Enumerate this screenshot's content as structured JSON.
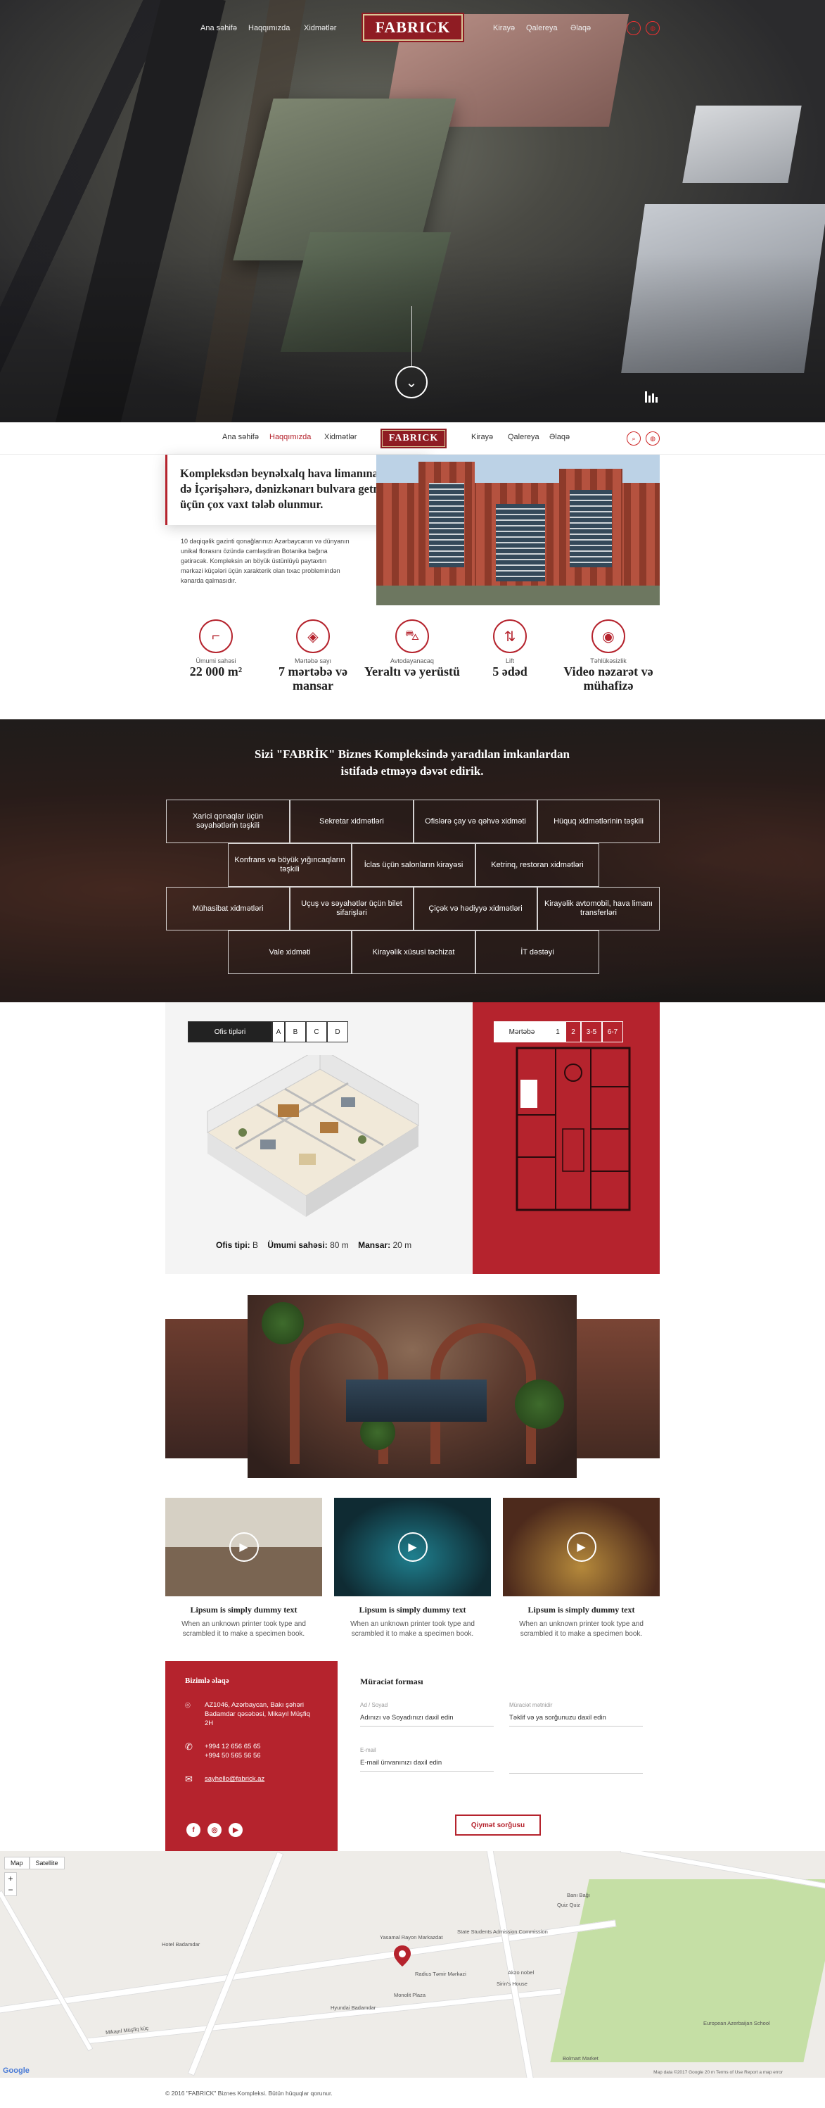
{
  "nav": {
    "items_left": [
      "Ana səhifə",
      "Haqqımızda",
      "Xidmətlər"
    ],
    "items_right": [
      "Kirayə",
      "Qalereya",
      "Əlaqə"
    ],
    "logo": "FABRICK",
    "active": "Haqqımızda"
  },
  "about": {
    "headline": "Kompleksdən beynəlxalq hava limanına, eləcə də İçərişəhərə, dənizkənarı bulvara getmək üçün çox vaxt tələb olunmur.",
    "text": "10 dəqiqəlik gəzinti qonağlarınızı Azərbaycanın və dünyanın unikal florasını özündə cəmləşdirən Botanika bağına gətirəcək. Kompleksin ən böyük üstünlüyü paytaxtın mərkəzi küçələri üçün xarakterik olan tıxac problemindən kənarda qalmasıdır."
  },
  "features": [
    {
      "label": "Ümumi sahəsi",
      "value": "22 000 m²",
      "icon": "area-icon"
    },
    {
      "label": "Mərtəbə sayı",
      "value": "7 mərtəbə və mansar",
      "icon": "layers-icon"
    },
    {
      "label": "Avtodayanacaq",
      "value": "Yeraltı və yerüstü",
      "icon": "car-icon"
    },
    {
      "label": "Lift",
      "value": "5 ədəd",
      "icon": "lift-icon"
    },
    {
      "label": "Təhlükəsizlik",
      "value": "Video nəzarət və mühafizə",
      "icon": "camera-icon"
    }
  ],
  "services": {
    "title": "Sizi \"FABRİK\" Biznes Kompleksində yaradılan imkanlardan istifadə etməyə dəvət edirik.",
    "items": [
      "Xarici qonaqlar üçün səyahətlərin təşkili",
      "Sekretar xidmətləri",
      "Ofislərə çay və qəhvə xidməti",
      "Hüquq xidmətlərinin təşkili",
      "Konfrans və böyük yığıncaqların təşkili",
      "İclas üçün salonların kirayəsi",
      "Ketrinq, restoran xidmətləri",
      "Mühasibat xidmətləri",
      "Uçuş və səyahətlər üçün bilet sifarişləri",
      "Çiçək və hədiyyə xidmətləri",
      "Kirayəlik avtomobil, hava limanı transferləri",
      "Vale xidməti",
      "Kirayəlik xüsusi təchizat",
      "İT dəstəyi"
    ]
  },
  "plans": {
    "office_tab_label": "Ofis tipləri",
    "office_tabs": [
      "A",
      "B",
      "C",
      "D"
    ],
    "floor_tab_label": "Mərtəbə",
    "floor_tabs": [
      "1",
      "2",
      "3-5",
      "6-7"
    ],
    "caption": {
      "type_label": "Ofis tipi:",
      "type_value": "B",
      "area_label": "Ümumi sahəsi:",
      "area_value": "80 m",
      "attic_label": "Mansar:",
      "attic_value": "20 m"
    }
  },
  "videos": [
    {
      "title": "Lipsum is simply dummy text",
      "desc": "When an unknown printer took type and scrambled it to make a specimen book."
    },
    {
      "title": "Lipsum is simply dummy text",
      "desc": "When an unknown printer took type and scrambled it to make a specimen book."
    },
    {
      "title": "Lipsum is simply dummy text",
      "desc": "When an unknown printer took type and scrambled it to make a specimen book."
    }
  ],
  "contact": {
    "title": "Bizimlə əlaqə",
    "address": "AZ1046, Azərbaycan, Bakı şəhəri Badamdar qəsəbəsi, Mikayıl Müşfiq 2H",
    "phone1": "+994 12 656 65 65",
    "phone2": "+994 50 565 56 56",
    "email": "sayhello@fabrick.az",
    "socials": [
      "f",
      "◎",
      "▶"
    ]
  },
  "form": {
    "title": "Müraciət forması",
    "name_label": "Ad / Soyad",
    "name_placeholder": "Adınızı və Soyadınızı daxil edin",
    "message_label": "Müraciət mətnidir",
    "message_placeholder": "Təklif və ya sorğunuzu daxil edin",
    "email_label": "E-mail",
    "email_placeholder": "E-mail ünvanınızı daxil edin",
    "submit": "Qiymət sorğusu"
  },
  "map": {
    "tabs": [
      "Map",
      "Satellite"
    ],
    "labels": [
      "Hotel Badamdar",
      "Yasamal Rayon Markazdat",
      "Radius Təmir Mərkəzi",
      "Akzo nobel",
      "Sirin's House",
      "Monolit Plaza",
      "Hyundai Badamdar",
      "Mikayıl Müşfiq küç",
      "Bolmart Market",
      "European Azerbaijan School",
      "Quiz Quiz",
      "State Students Admission Commission",
      "Banı Bağı"
    ],
    "attribution": "Map data ©2017 Google  20 m  Terms of Use  Report a map error",
    "google": "Google"
  },
  "footer": {
    "copyright": "© 2016 \"FABRICK\" Biznes Kompleksi. Bütün hüquqlar qorunur."
  },
  "colors": {
    "accent": "#b5232d",
    "dark": "#222222"
  }
}
